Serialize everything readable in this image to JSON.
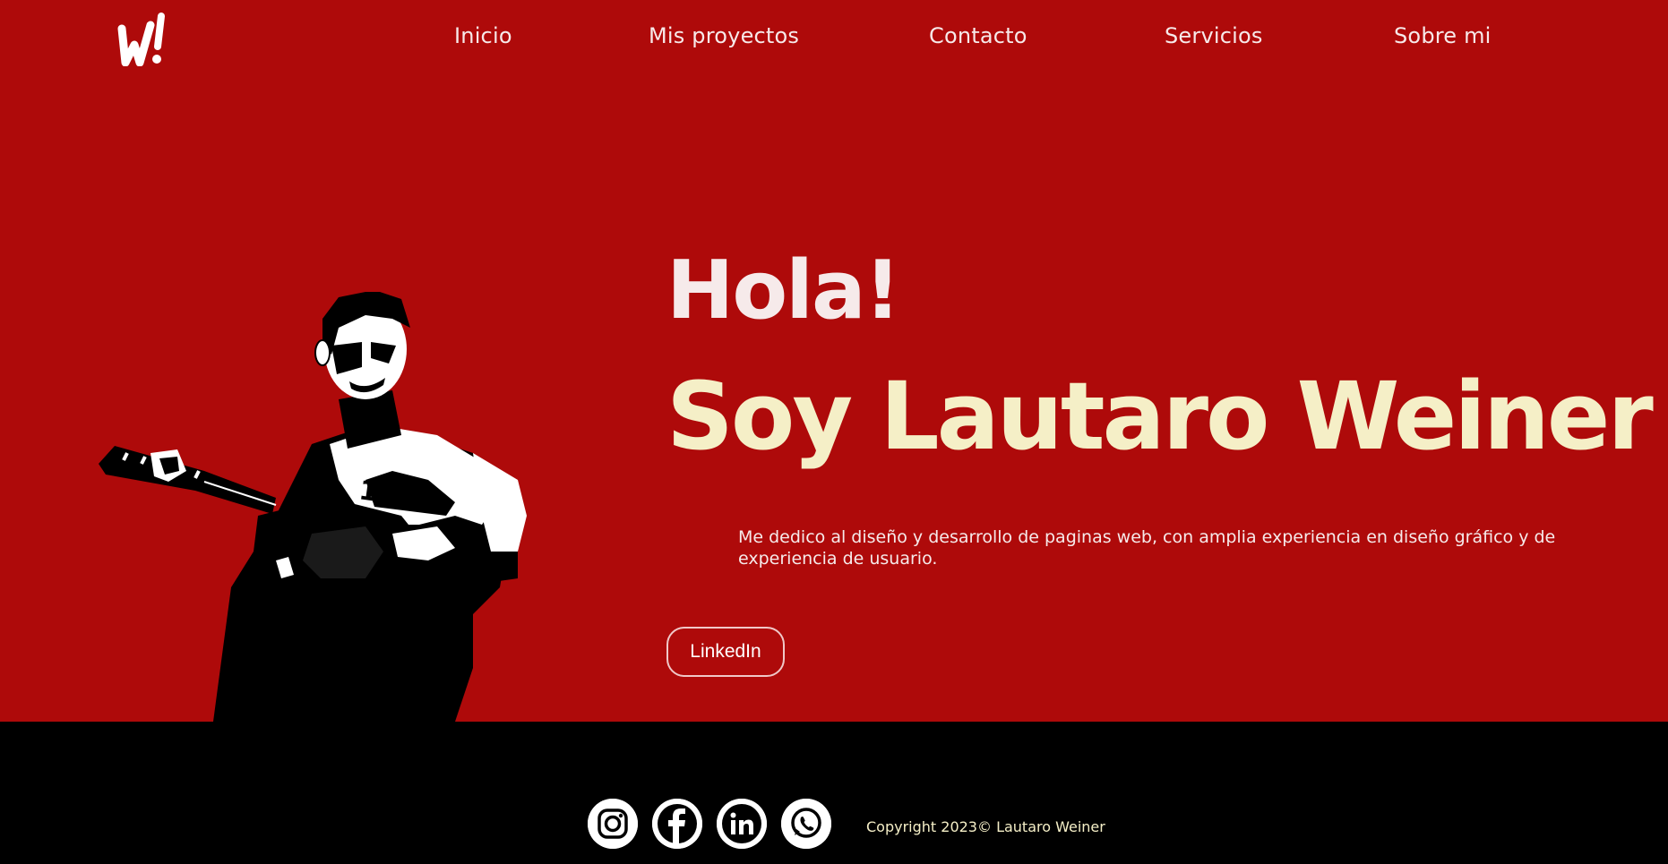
{
  "nav": {
    "items": [
      {
        "label": "Inicio"
      },
      {
        "label": "Mis proyectos"
      },
      {
        "label": "Contacto"
      },
      {
        "label": "Servicios"
      },
      {
        "label": "Sobre mi"
      }
    ]
  },
  "logo": {
    "icon": "brush-w-logo",
    "color": "#ffffff"
  },
  "hero": {
    "greeting": "Hola!",
    "name": "Soy Lautaro Weiner",
    "description": "Me dedico al diseño y desarrollo de paginas web, con amplia experiencia en diseño gráfico y de experiencia de usuario.",
    "cta_label": "LinkedIn",
    "photo_icon": "guitarist-portrait"
  },
  "footer": {
    "social": [
      {
        "icon": "instagram-icon"
      },
      {
        "icon": "facebook-icon"
      },
      {
        "icon": "linkedin-icon"
      },
      {
        "icon": "whatsapp-icon"
      }
    ],
    "copyright": "Copyright 2023© Lautaro Weiner"
  },
  "colors": {
    "hero_bg": "#ae0a0a",
    "footer_bg": "#000000",
    "name_color": "#f5efc7",
    "text_light": "#f6eaea"
  }
}
